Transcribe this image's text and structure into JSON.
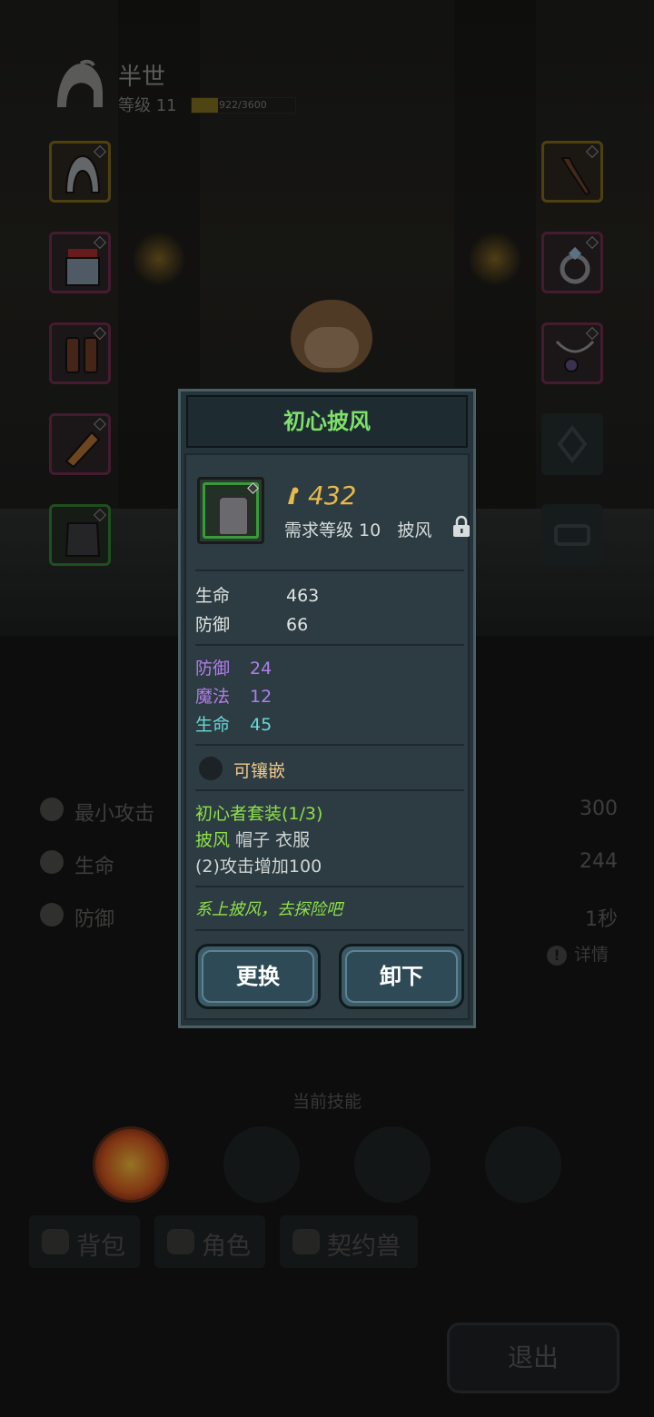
{
  "player": {
    "name": "半世",
    "level_label": "等级 11",
    "xp_text": "922/3600",
    "xp_fraction": 0.256
  },
  "equipment_slots": {
    "left": [
      "hood",
      "coat",
      "boots",
      "gloves",
      "cloak"
    ],
    "right": [
      "staff",
      "ring",
      "amulet",
      "gem",
      "accessory"
    ]
  },
  "stats": [
    {
      "label": "最小攻击",
      "value": "300",
      "icon": "sword-icon"
    },
    {
      "label": "生命",
      "value": "244",
      "icon": "heart-icon"
    },
    {
      "label": "防御",
      "value": "1秒",
      "icon": "shield-icon"
    }
  ],
  "detail_label": "详情",
  "skills_title": "当前技能",
  "tabs": [
    {
      "label": "背包",
      "icon": "bag-icon"
    },
    {
      "label": "角色",
      "icon": "character-icon"
    },
    {
      "label": "契约兽",
      "icon": "paw-icon"
    }
  ],
  "exit_label": "退出",
  "dialog": {
    "title": "初心披风",
    "price": "432",
    "requirement": "需求等级 10",
    "item_type": "披风",
    "base_stats": [
      {
        "label": "生命",
        "value": "463"
      },
      {
        "label": "防御",
        "value": "66"
      }
    ],
    "bonus_stats": [
      {
        "label": "防御",
        "value": "24",
        "color": "#b07ee8"
      },
      {
        "label": "魔法",
        "value": "12",
        "color": "#b07ee8"
      },
      {
        "label": "生命",
        "value": "45",
        "color": "#6ad6d6"
      }
    ],
    "socket_label": "可镶嵌",
    "set": {
      "title": "初心者套装(1/3)",
      "owned_piece": "披风",
      "other_pieces": "帽子 衣服",
      "bonus": "(2)攻击增加100"
    },
    "flavor": "系上披风，去探险吧",
    "buttons": {
      "replace": "更换",
      "unequip": "卸下"
    }
  },
  "colors": {
    "title_green": "#7fe06a",
    "price_gold": "#e8b84a",
    "set_green": "#8ee04a",
    "socket_orange": "#f0c88a"
  }
}
